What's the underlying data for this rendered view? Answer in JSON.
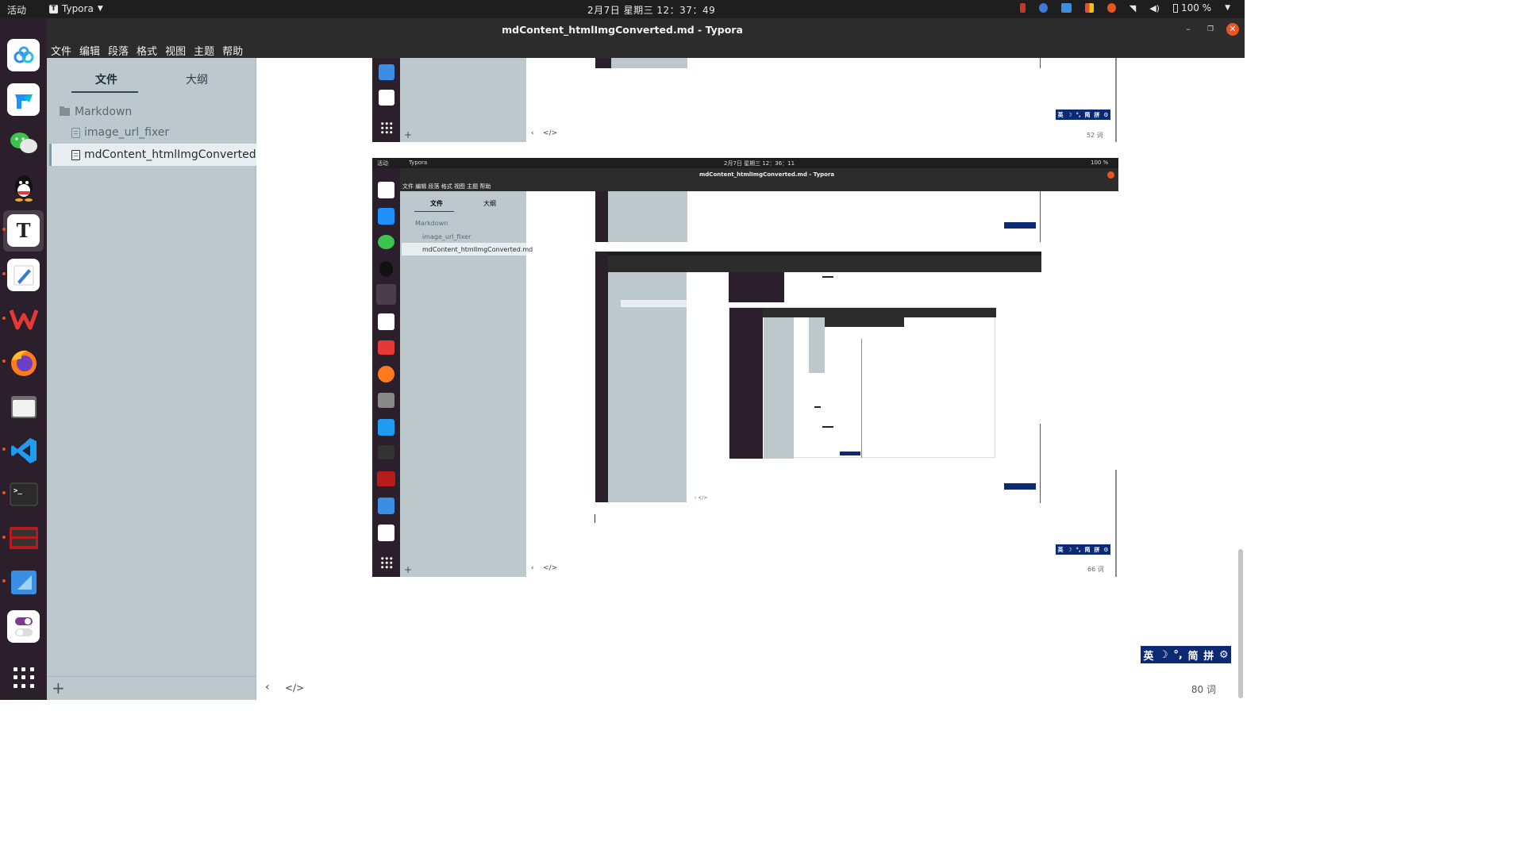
{
  "topbar": {
    "activities": "活动",
    "app_name": "Typora",
    "clock": "2月7日 星期三  12：37：49",
    "battery": "100 %"
  },
  "window": {
    "title": "mdContent_htmlImgConverted.md - Typora"
  },
  "menu": [
    "文件",
    "编辑",
    "段落",
    "格式",
    "视图",
    "主题",
    "帮助"
  ],
  "dock": {
    "items": [
      "baidu-netdisk",
      "feishu",
      "wechat",
      "qq",
      "typora",
      "text-editor",
      "wps",
      "firefox",
      "files",
      "vscode",
      "terminal",
      "screen-recorder",
      "remote-desktop",
      "settings-toggle"
    ]
  },
  "sidebar": {
    "tabs": [
      "文件",
      "大纲"
    ],
    "folder": "Markdown",
    "files": [
      "image_url_fixer",
      "mdContent_htmlImgConverted.md"
    ],
    "selected_file": "mdContent_htmlImgConverted.md"
  },
  "editor": {
    "word_count": "80 词"
  },
  "nested_shot_1": {
    "word_count": "52 词"
  },
  "nested_shot_2": {
    "activities": "活动",
    "app_name": "Typora",
    "clock": "2月7日 星期三  12：36：11",
    "battery": "100 %",
    "title": "mdContent_htmlImgConverted.md - Typora",
    "menu": [
      "文件",
      "编辑",
      "段落",
      "格式",
      "视图",
      "主题",
      "帮助"
    ],
    "tabs": [
      "文件",
      "大纲"
    ],
    "folder": "Markdown",
    "files": [
      "image_url_fixer",
      "mdContent_htmlImgConverted.md"
    ],
    "word_count": "66 词"
  },
  "ime": [
    "英",
    "☽",
    "°,",
    "简",
    "拼",
    "⚙"
  ],
  "colors": {
    "accent": "#e95420",
    "sidebar_bg": "#bdc8cd",
    "dock_bg": "#2a1f2a",
    "ime_bg": "#0c2a73"
  }
}
